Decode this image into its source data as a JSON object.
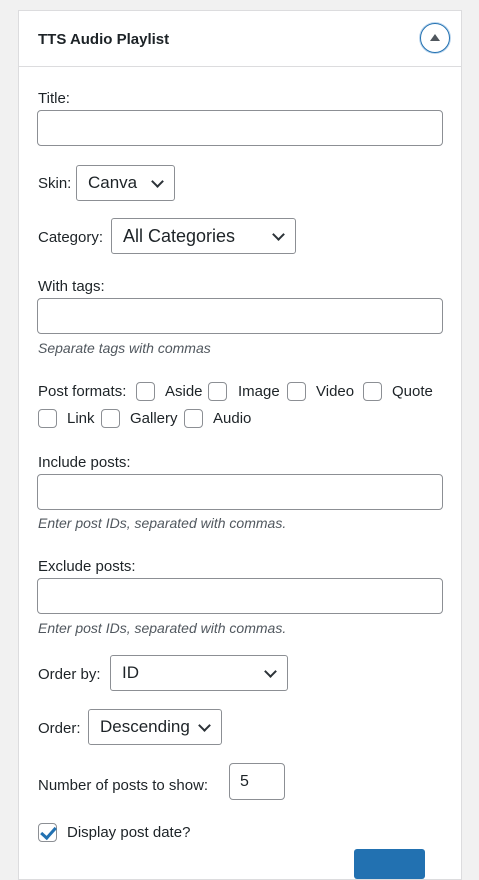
{
  "widget": {
    "title": "TTS Audio Playlist",
    "toggle_icon": "arrow-up-icon"
  },
  "fields": {
    "title_label": "Title:",
    "title_value": "",
    "skin_label": "Skin:",
    "skin_value": "Canva",
    "category_label": "Category:",
    "category_value": "All Categories",
    "tags_label": "With tags:",
    "tags_value": "",
    "tags_hint": "Separate tags with commas",
    "post_formats_label": "Post formats:",
    "post_formats": [
      {
        "label": "Aside",
        "checked": false
      },
      {
        "label": "Image",
        "checked": false
      },
      {
        "label": "Video",
        "checked": false
      },
      {
        "label": "Quote",
        "checked": false
      },
      {
        "label": "Link",
        "checked": false
      },
      {
        "label": "Gallery",
        "checked": false
      },
      {
        "label": "Audio",
        "checked": false
      }
    ],
    "include_label": "Include posts:",
    "include_value": "",
    "include_hint": "Enter post IDs, separated with commas.",
    "exclude_label": "Exclude posts:",
    "exclude_value": "",
    "exclude_hint": "Enter post IDs, separated with commas.",
    "orderby_label": "Order by:",
    "orderby_value": "ID",
    "order_label": "Order:",
    "order_value": "Descending",
    "num_label": "Number of posts to show:",
    "num_value": "5",
    "date_label": "Display post date?",
    "date_checked": true
  },
  "colors": {
    "accent": "#2271b1",
    "border": "#8c8f94",
    "hint": "#50575e"
  }
}
